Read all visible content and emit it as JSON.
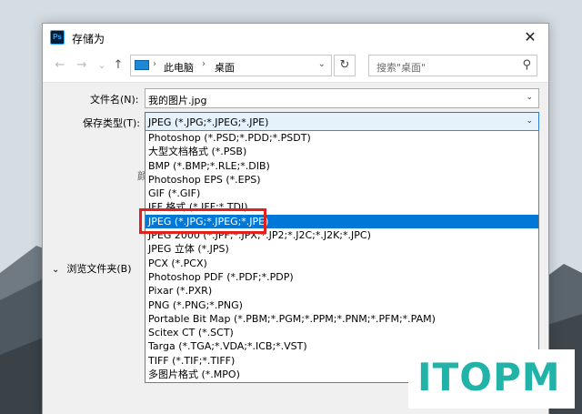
{
  "window": {
    "title": "存储为",
    "app_icon": "Ps",
    "close_glyph": "✕"
  },
  "nav": {
    "back_glyph": "←",
    "forward_glyph": "→",
    "dropdown_glyph": "⌄",
    "up_glyph": "↑",
    "breadcrumb": [
      "此电脑",
      "桌面"
    ],
    "path_dropdown_glyph": "⌄",
    "refresh_glyph": "↻",
    "search_placeholder": "搜索\"桌面\"",
    "search_glyph": "⚲"
  },
  "form": {
    "filename_label": "文件名(N):",
    "filename_value": "我的图片.jpg",
    "filetype_label": "保存类型(T):",
    "filetype_value": "JPEG (*.JPG;*.JPEG;*.JPE)",
    "behind_clip": "颜",
    "browse_folders_label": "浏览文件夹(B)"
  },
  "dropdown": {
    "selected_index": 6,
    "items": [
      "Photoshop (*.PSD;*.PDD;*.PSDT)",
      "大型文档格式 (*.PSB)",
      "BMP (*.BMP;*.RLE;*.DIB)",
      "Photoshop EPS (*.EPS)",
      "GIF (*.GIF)",
      "IFF 格式 (*.IFF;*.TDI)",
      "JPEG (*.JPG;*.JPEG;*.JPE)",
      "JPEG 2000 (*.JPF;*.JPX;*.JP2;*.J2C;*.J2K;*.JPC)",
      "JPEG 立体 (*.JPS)",
      "PCX (*.PCX)",
      "Photoshop PDF (*.PDF;*.PDP)",
      "Pixar (*.PXR)",
      "PNG (*.PNG;*.PNG)",
      "Portable Bit Map (*.PBM;*.PGM;*.PPM;*.PNM;*.PFM;*.PAM)",
      "Scitex CT (*.SCT)",
      "Targa (*.TGA;*.VDA;*.ICB;*.VST)",
      "TIFF (*.TIF;*.TIFF)",
      "多图片格式 (*.MPO)"
    ]
  },
  "watermark": {
    "text": "ITOPM"
  },
  "colors": {
    "selection": "#0078d7",
    "highlight": "#e0211c",
    "watermark": "#21b3a7"
  }
}
